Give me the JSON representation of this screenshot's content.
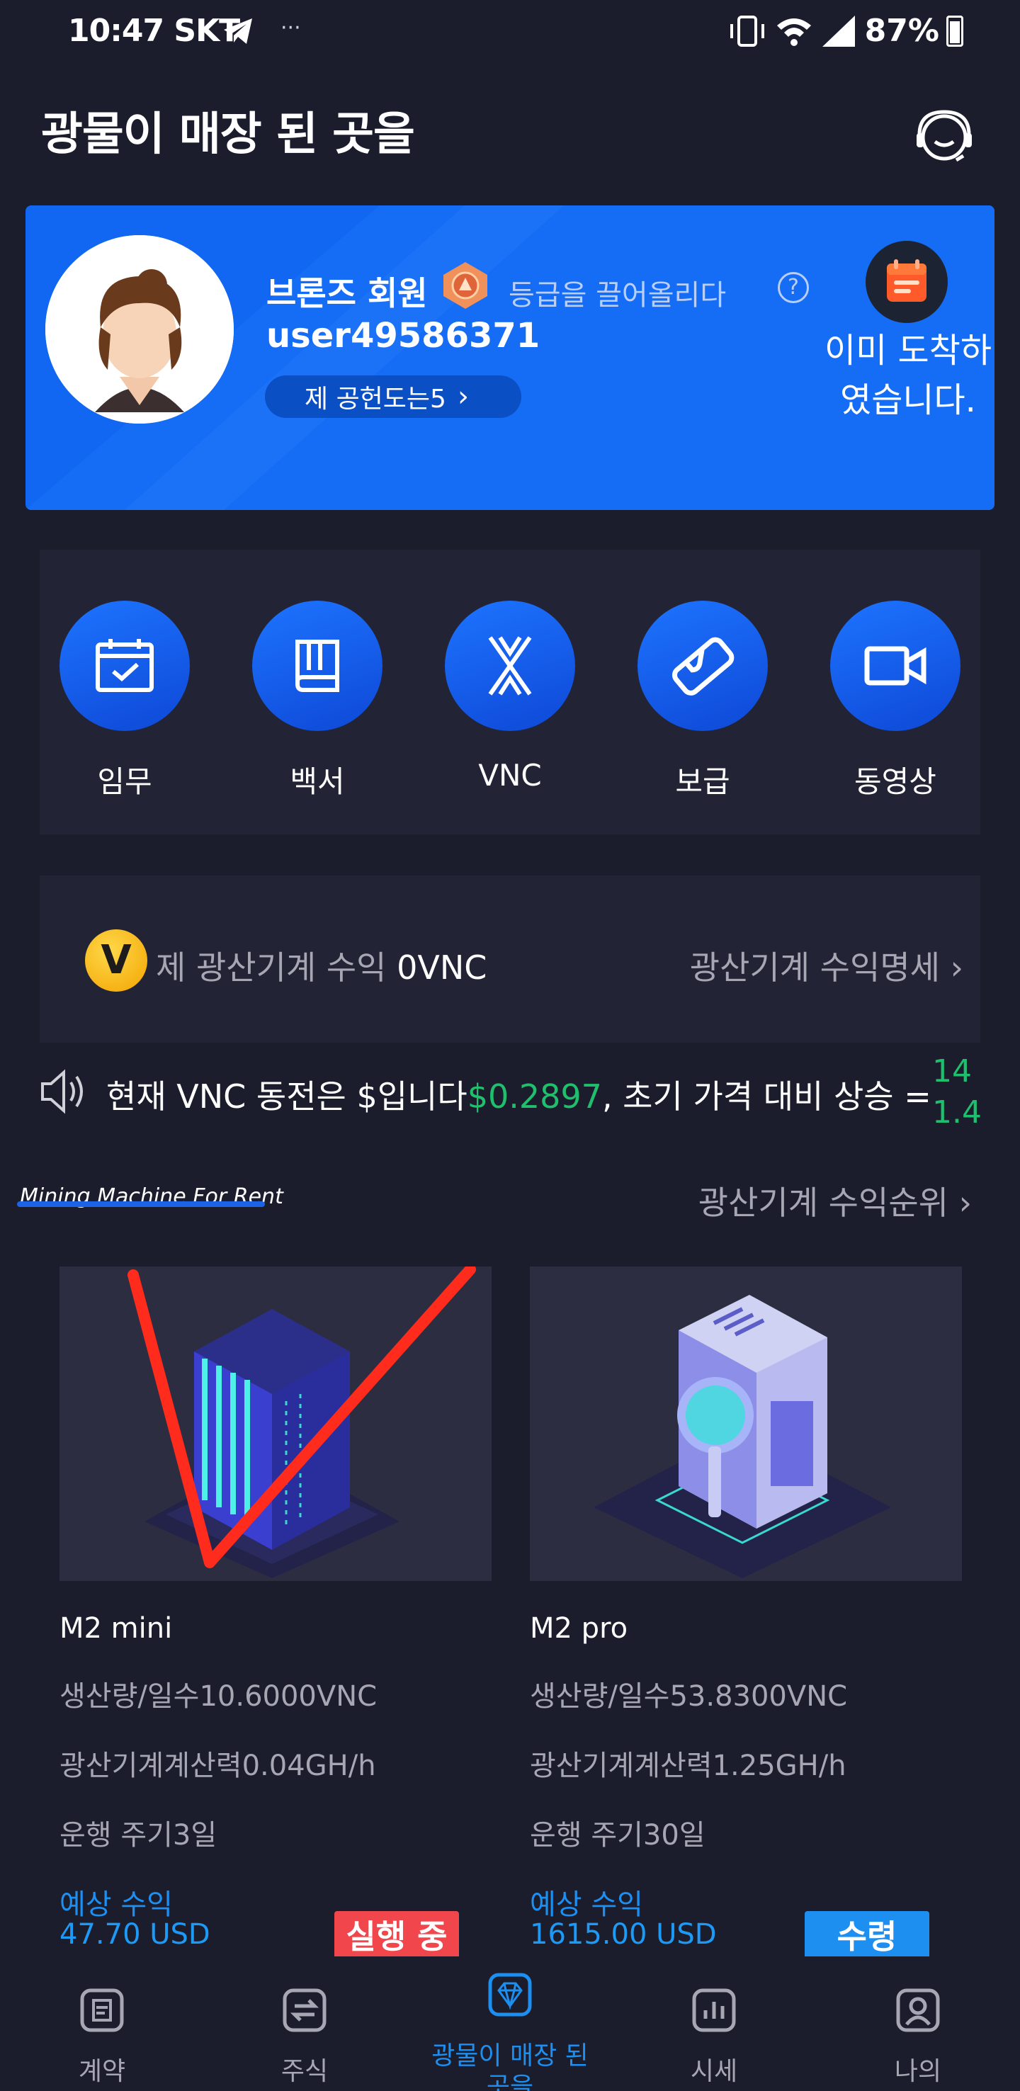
{
  "status_bar": {
    "time": "10:47 SKT",
    "extra": "···",
    "battery": "87%"
  },
  "header": {
    "title": "광물이 매장 된 곳을"
  },
  "member_card": {
    "grade": "브론즈 회원",
    "upgrade_link": "등급을 끌어올리다",
    "username": "user49586371",
    "contribution": "제 공헌도는5",
    "checkin_label": "이미 도착하였습니다."
  },
  "menu": {
    "items": [
      {
        "label": "임무",
        "icon": "calendar-icon"
      },
      {
        "label": "백서",
        "icon": "book-icon"
      },
      {
        "label": "VNC",
        "icon": "vnc-logo-icon"
      },
      {
        "label": "보급",
        "icon": "handshake-icon"
      },
      {
        "label": "동영상",
        "icon": "video-icon"
      }
    ]
  },
  "earnings": {
    "coin_letter": "V",
    "label": "제 광산기계 수익",
    "value": "0VNC",
    "detail_link": "광산기계 수익명세"
  },
  "ticker": {
    "prefix": "현재 VNC 동전은 $입니다",
    "price": "$0.2897",
    "suffix": ", 초기 가격 대비 상승 =",
    "side_line1": "14",
    "side_line2": "1.4"
  },
  "section": {
    "title": "Mining Machine For Rent",
    "ranking_link": "광산기계 수익순위"
  },
  "products": [
    {
      "name": "M2 mini",
      "output": "생산량/일수10.6000VNC",
      "hashrate": "광산기계계산력0.04GH/h",
      "cycle": "운행 주기3일",
      "expected_label": "예상 수익",
      "price": "47.70 USD",
      "button": "실행 중",
      "button_color": "#f0464c"
    },
    {
      "name": "M2 pro",
      "output": "생산량/일수53.8300VNC",
      "hashrate": "광산기계계산력1.25GH/h",
      "cycle": "운행 주기30일",
      "expected_label": "예상 수익",
      "price": "1615.00 USD",
      "button": "수령",
      "button_color": "#1d8ff0"
    }
  ],
  "bottom_nav": {
    "items": [
      {
        "label": "계약",
        "icon": "contract-icon",
        "active": false
      },
      {
        "label": "주식",
        "icon": "exchange-icon",
        "active": false
      },
      {
        "label": "광물이 매장 된 곳을",
        "icon": "diamond-icon",
        "active": true
      },
      {
        "label": "시세",
        "icon": "chart-icon",
        "active": false
      },
      {
        "label": "나의",
        "icon": "profile-icon",
        "active": false
      }
    ]
  },
  "colors": {
    "background": "#1b1c2c",
    "panel": "#222335",
    "card_blue": "#1167f2",
    "accent_blue": "#1d8ff0",
    "price_green": "#1fbf6e",
    "running_red": "#f0464c"
  }
}
